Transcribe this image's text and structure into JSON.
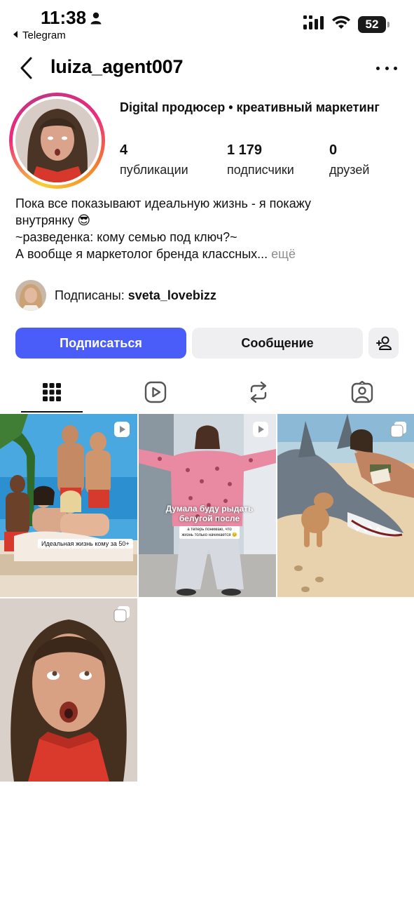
{
  "status_bar": {
    "time": "11:38",
    "back_app": "Telegram",
    "battery": "52"
  },
  "header": {
    "username": "luiza_agent007"
  },
  "profile": {
    "full_name": "Digital продюсер • креативный маркетинг",
    "stats": [
      {
        "value": "4",
        "label": "публикации"
      },
      {
        "value": "1 179",
        "label": "подписчики"
      },
      {
        "value": "0",
        "label": "друзей"
      }
    ],
    "bio_lines": [
      "Пока все показывают идеальную жизнь - я покажу",
      "внутрянку 😎",
      "~разведенка: кому семью под ключ?~",
      "А вообще я маркетолог бренда классных..."
    ],
    "bio_more": "ещё",
    "followed_by_label": "Подписаны:",
    "followed_by_user": "sveta_lovebizz"
  },
  "actions": {
    "follow": "Подписаться",
    "message": "Сообщение"
  },
  "posts": [
    {
      "type": "reel",
      "caption": "Идеальная жизнь кому за 50+"
    },
    {
      "type": "reel",
      "caption": "Думала буду рыдать белугой после развода",
      "subcaption": "а теперь понимаю, что жизнь только начинается 😊"
    },
    {
      "type": "carousel"
    },
    {
      "type": "carousel"
    }
  ],
  "colors": {
    "follow_button": "#4a5df9",
    "secondary_button": "#efeff2",
    "muted_text": "#8e8e8e"
  }
}
